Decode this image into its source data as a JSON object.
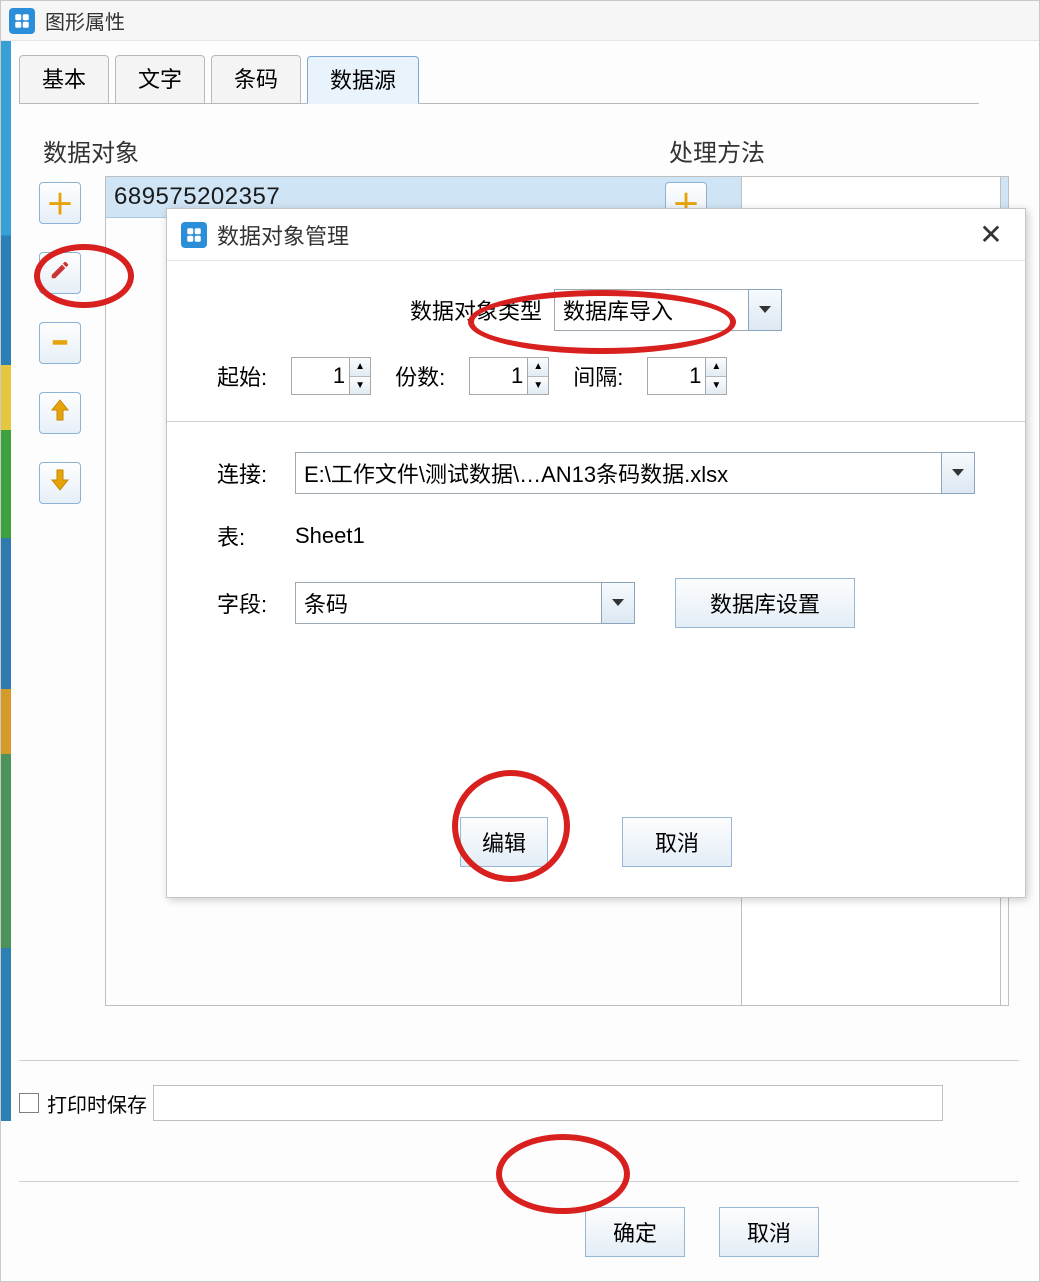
{
  "parent": {
    "title": "图形属性",
    "tabs": [
      "基本",
      "文字",
      "条码",
      "数据源"
    ],
    "active_tab_index": 3,
    "data_object": {
      "label": "数据对象",
      "rows": [
        "689575202357"
      ]
    },
    "processing_method": {
      "label": "处理方法"
    },
    "tool_icons": {
      "add": "add-icon",
      "edit": "edit-icon",
      "remove": "remove-icon",
      "up": "up-arrow-icon",
      "down": "down-arrow-icon"
    },
    "print_save": {
      "checkbox_label": "打印时保存",
      "value": ""
    },
    "buttons": {
      "ok": "确定",
      "cancel": "取消"
    }
  },
  "modal": {
    "title": "数据对象管理",
    "type_row": {
      "label": "数据对象类型",
      "value": "数据库导入"
    },
    "start": {
      "label": "起始:",
      "value": "1"
    },
    "copies": {
      "label": "份数:",
      "value": "1"
    },
    "gap": {
      "label": "间隔:",
      "value": "1"
    },
    "connection": {
      "label": "连接:",
      "value": "E:\\工作文件\\测试数据\\…AN13条码数据.xlsx"
    },
    "table": {
      "label": "表:",
      "value": "Sheet1"
    },
    "field": {
      "label": "字段:",
      "value": "条码"
    },
    "db_settings_btn": "数据库设置",
    "buttons": {
      "edit": "编辑",
      "cancel": "取消"
    }
  }
}
